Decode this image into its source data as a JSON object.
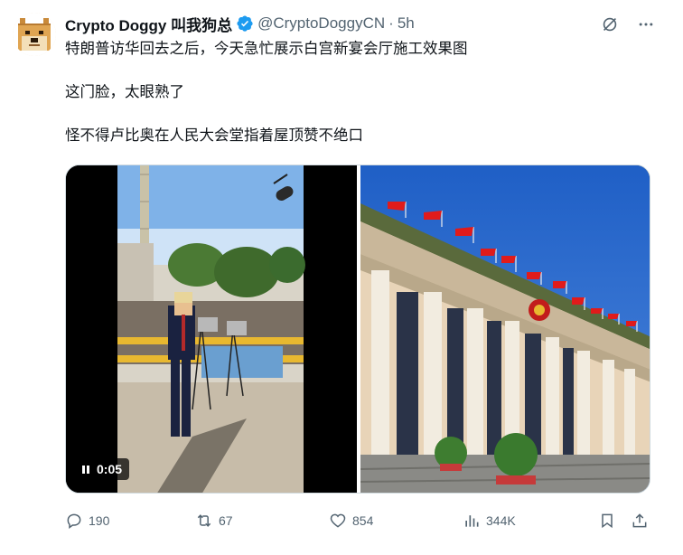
{
  "author": {
    "display_name": "Crypto Doggy 叫我狗总",
    "handle": "@CryptoDoggyCN",
    "separator": "·",
    "time": "5h",
    "avatar_icon": "doge-avatar",
    "verified_icon": "verified-badge-icon",
    "verified_color": "#1d9bf0"
  },
  "post": {
    "paragraphs": [
      "特朗普访华回去之后，今天急忙展示白宫新宴会厅施工效果图",
      "这门脸，太眼熟了",
      "怪不得卢比奥在人民大会堂指着屋顶赞不绝口"
    ]
  },
  "media": {
    "video": {
      "time_label": "0:05",
      "state": "paused-control-shown"
    },
    "photo": {
      "subject": "building-with-red-flags"
    }
  },
  "actions": {
    "reply_count": "190",
    "repost_count": "67",
    "like_count": "854",
    "view_count": "344K"
  },
  "colors": {
    "text_primary": "#0f1419",
    "text_secondary": "#536471",
    "accent": "#1d9bf0",
    "border": "#cfd9de"
  }
}
